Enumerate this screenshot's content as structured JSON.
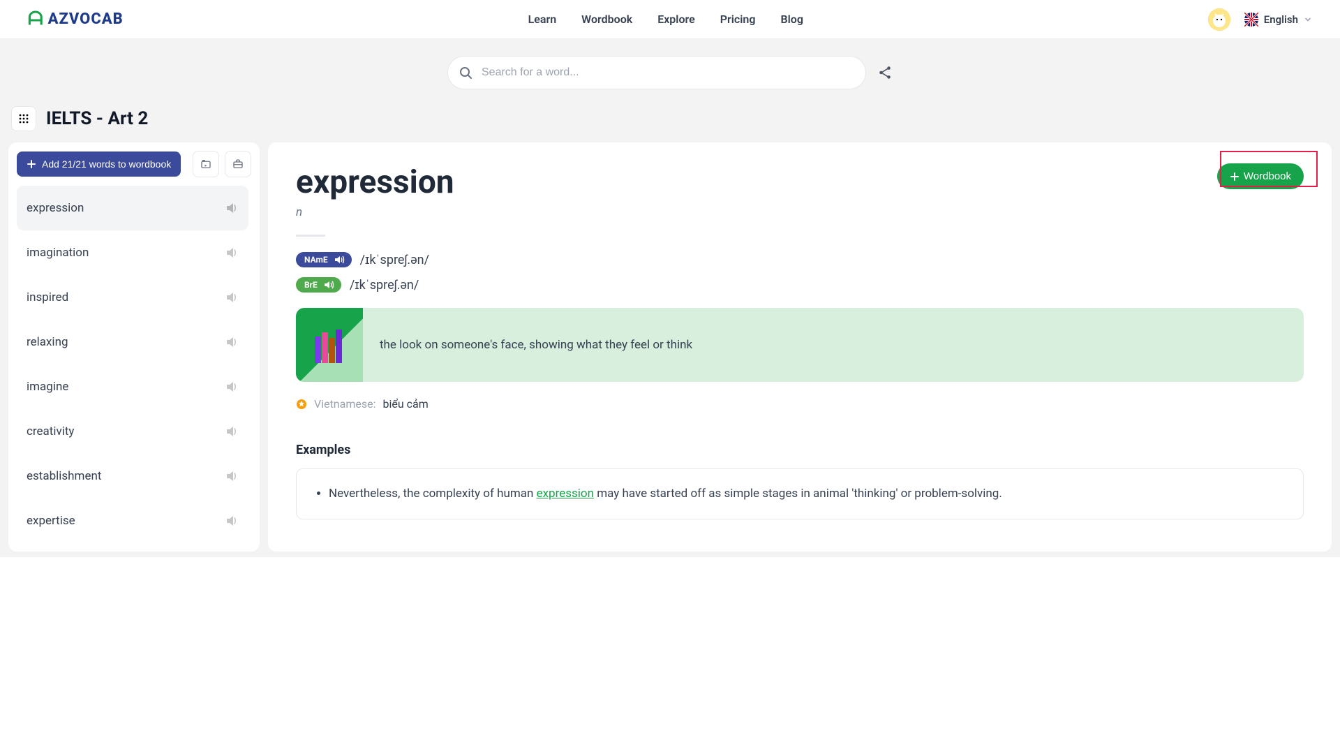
{
  "brand": "AZVOCAB",
  "nav": {
    "learn": "Learn",
    "wordbook": "Wordbook",
    "explore": "Explore",
    "pricing": "Pricing",
    "blog": "Blog"
  },
  "language": "English",
  "search": {
    "placeholder": "Search for a word..."
  },
  "lesson_title": "IELTS - Art 2",
  "sidebar": {
    "add_label": "Add 21/21 words to wordbook",
    "items": [
      {
        "word": "expression"
      },
      {
        "word": "imagination"
      },
      {
        "word": "inspired"
      },
      {
        "word": "relaxing"
      },
      {
        "word": "imagine"
      },
      {
        "word": "creativity"
      },
      {
        "word": "establishment"
      },
      {
        "word": "expertise"
      }
    ]
  },
  "detail": {
    "word": "expression",
    "pos": "n",
    "wordbook_btn": "Wordbook",
    "pron": {
      "name_label": "NAmE",
      "bre_label": "BrE",
      "name_ipa": "/ɪkˈspreʃ.ən/",
      "bre_ipa": "/ɪkˈspreʃ.ən/"
    },
    "definition": "the look on someone's face, showing what they feel or think",
    "translation_label": "Vietnamese:",
    "translation_value": "biểu cảm",
    "examples_heading": "Examples",
    "example_pre": "Nevertheless, the complexity of human ",
    "example_kw": "expression",
    "example_post": " may have started off as simple stages in animal 'thinking' or problem-solving."
  }
}
